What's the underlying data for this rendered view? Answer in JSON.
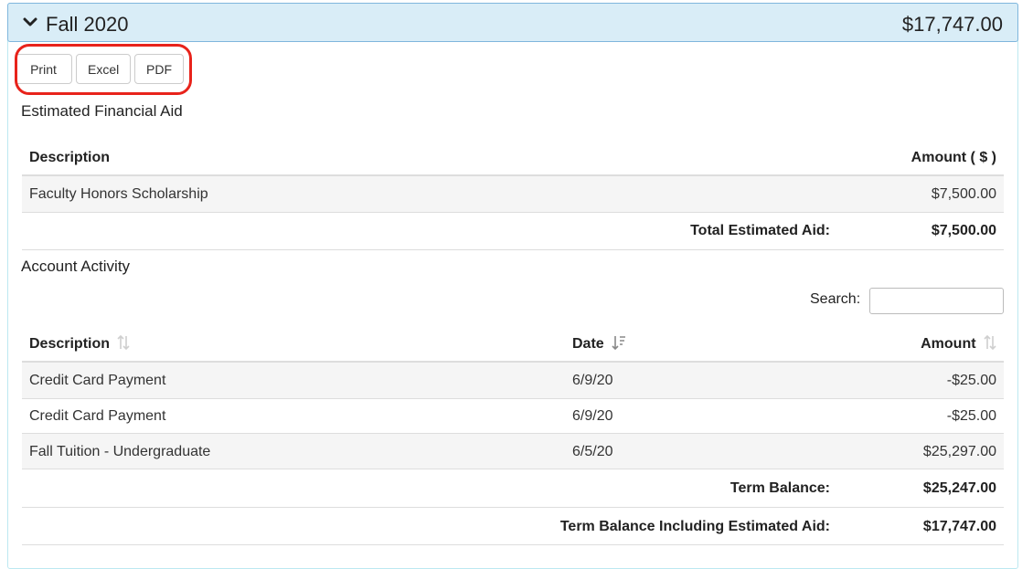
{
  "term": {
    "title": "Fall 2020",
    "total": "$17,747.00"
  },
  "export": {
    "print_label": "Print",
    "excel_label": "Excel",
    "pdf_label": "PDF"
  },
  "aid": {
    "section_title": "Estimated Financial Aid",
    "headers": {
      "description": "Description",
      "amount": "Amount ( $ )"
    },
    "rows": [
      {
        "description": "Faculty Honors Scholarship",
        "amount": "$7,500.00"
      }
    ],
    "total_label": "Total Estimated Aid:",
    "total_value": "$7,500.00"
  },
  "activity": {
    "section_title": "Account Activity",
    "search_label": "Search:",
    "search_value": "",
    "headers": {
      "description": "Description",
      "date": "Date",
      "amount": "Amount"
    },
    "rows": [
      {
        "description": "Credit Card Payment",
        "date": "6/9/20",
        "amount": "-$25.00"
      },
      {
        "description": "Credit Card Payment",
        "date": "6/9/20",
        "amount": "-$25.00"
      },
      {
        "description": "Fall Tuition - Undergraduate",
        "date": "6/5/20",
        "amount": "$25,297.00"
      }
    ],
    "term_balance_label": "Term Balance:",
    "term_balance_value": "$25,247.00",
    "term_balance_aid_label": "Term Balance Including Estimated Aid:",
    "term_balance_aid_value": "$17,747.00"
  },
  "colors": {
    "heading_bg": "#d9edf7",
    "highlight": "#e8231b",
    "stripe": "#f5f5f5"
  }
}
